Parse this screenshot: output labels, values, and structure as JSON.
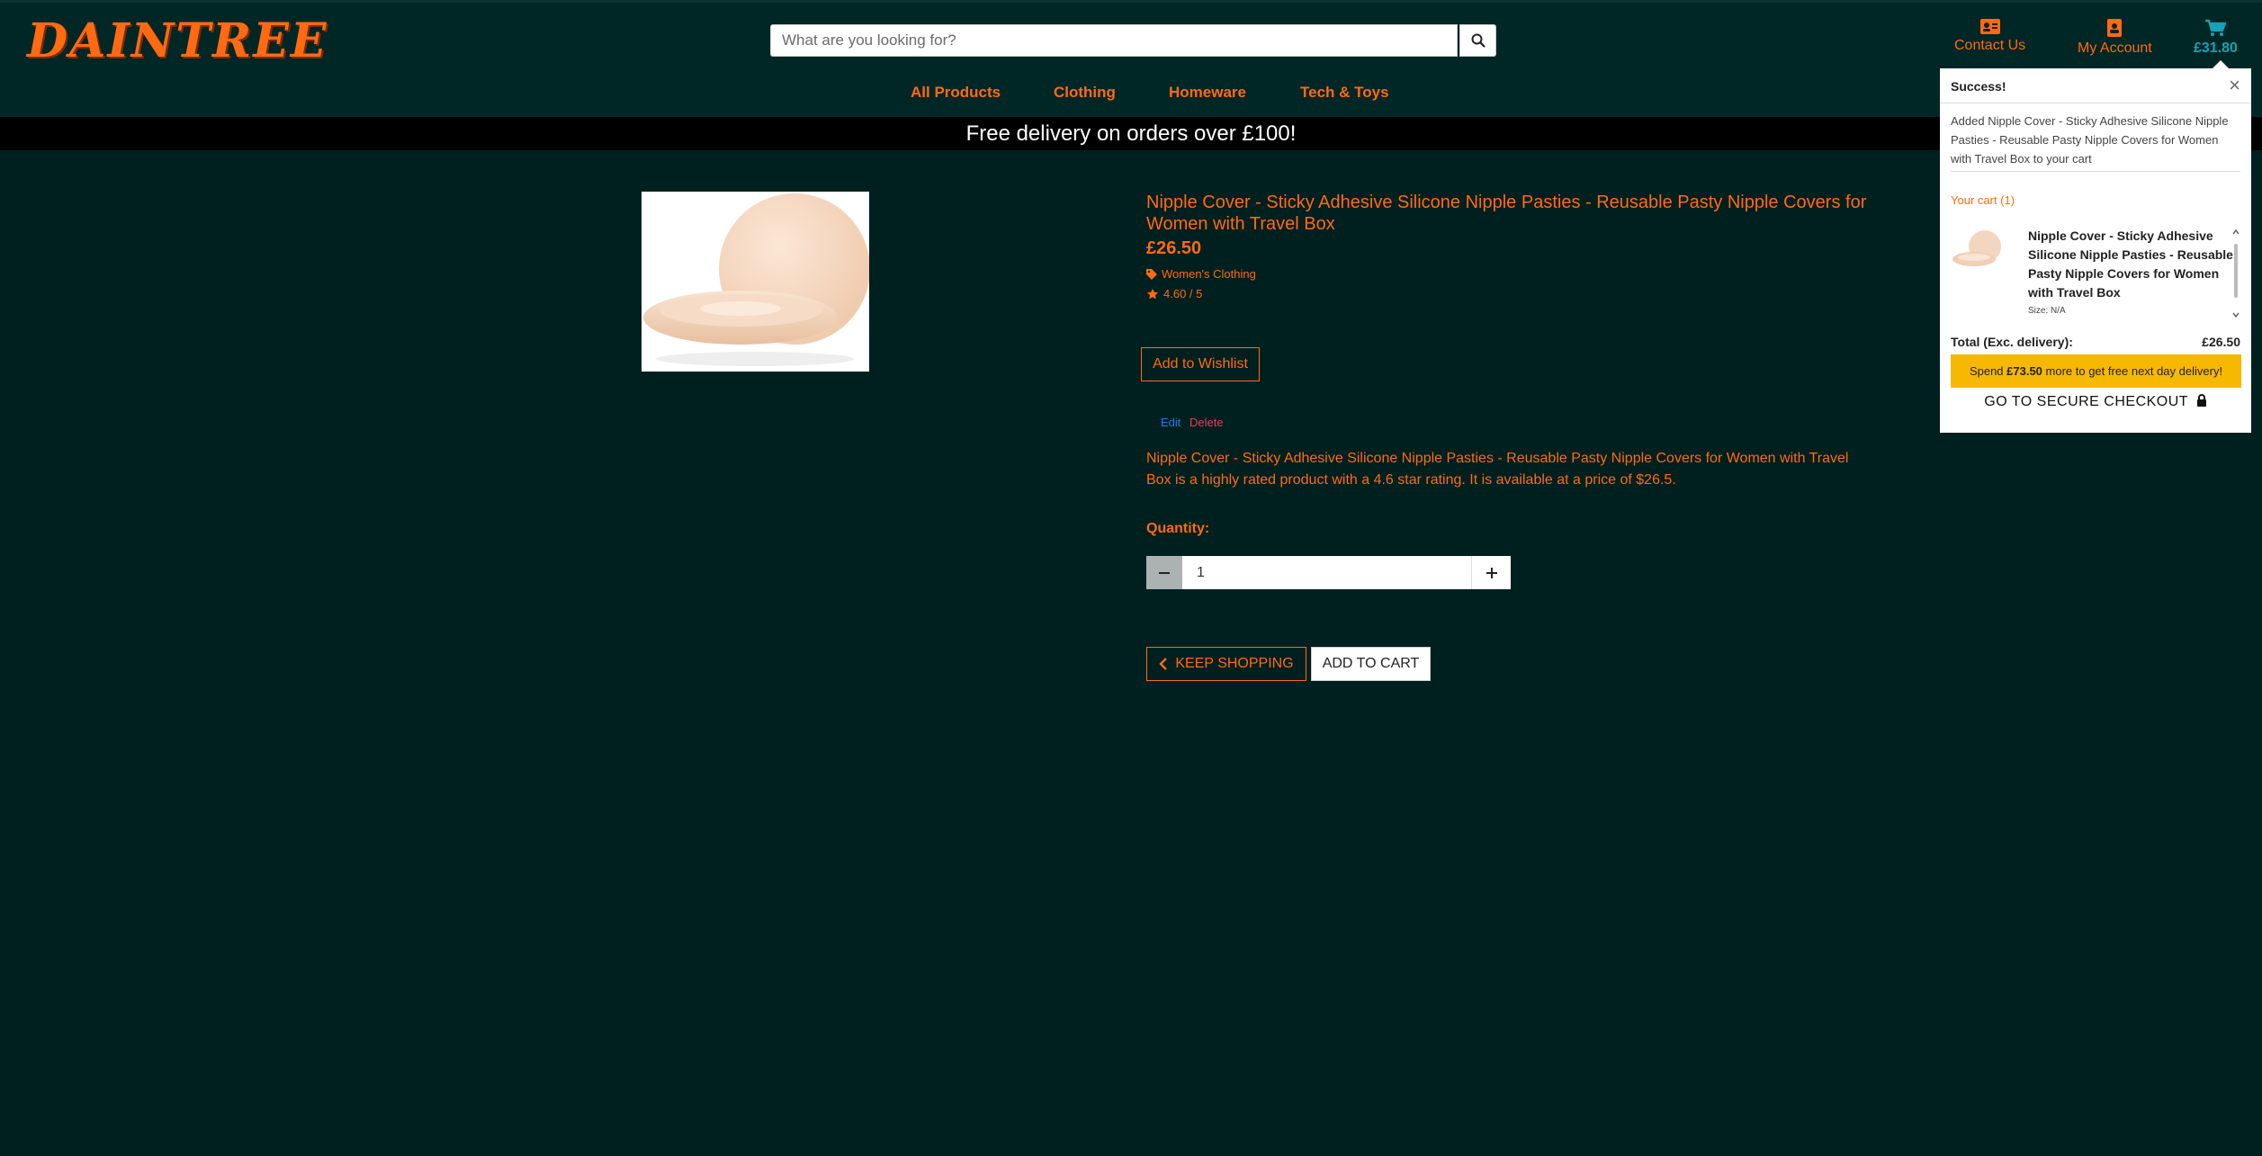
{
  "brand": {
    "logo_text": "DAINTREE",
    "accent": "#ff6a13",
    "background": "#001f1f"
  },
  "search": {
    "placeholder": "What are you looking for?",
    "button_icon": "search-icon"
  },
  "header_links": {
    "contact": "Contact Us",
    "account": "My Account",
    "cart_total": "£31.80"
  },
  "nav": {
    "items": [
      "All Products",
      "Clothing",
      "Homeware",
      "Tech & Toys"
    ]
  },
  "promo": {
    "text": "Free delivery on orders over £100!"
  },
  "product": {
    "title": "Nipple Cover - Sticky Adhesive Silicone Nipple Pasties - Reusable Pasty Nipple Covers for Women with Travel Box",
    "price": "£26.50",
    "category": "Women's Clothing",
    "rating": "4.60 / 5",
    "wishlist_label": "Add to Wishlist",
    "edit_label": "Edit",
    "delete_label": "Delete",
    "description": "Nipple Cover - Sticky Adhesive Silicone Nipple Pasties - Reusable Pasty Nipple Covers for Women with Travel Box is a highly rated product with a 4.6 star rating. It is available at a price of $26.5.",
    "quantity_label": "Quantity:",
    "quantity_value": "1",
    "keep_shopping_label": "KEEP SHOPPING",
    "add_to_cart_label": "ADD TO CART"
  },
  "cart_popup": {
    "title": "Success!",
    "message": "Added Nipple Cover - Sticky Adhesive Silicone Nipple Pasties - Reusable Pasty Nipple Covers for Women with Travel Box to your cart",
    "your_cart": "Your cart (1)",
    "item_name": "Nipple Cover - Sticky Adhesive Silicone Nipple Pasties - Reusable Pasty Nipple Covers for Women with Travel Box",
    "item_size": "Size: N/A",
    "total_label": "Total (Exc. delivery):",
    "total_value": "£26.50",
    "spend_prefix": "Spend ",
    "spend_amount": "£73.50",
    "spend_suffix": " more to get free next day delivery!",
    "checkout_label": "GO TO SECURE CHECKOUT",
    "spend_bg": "#f6b800"
  }
}
